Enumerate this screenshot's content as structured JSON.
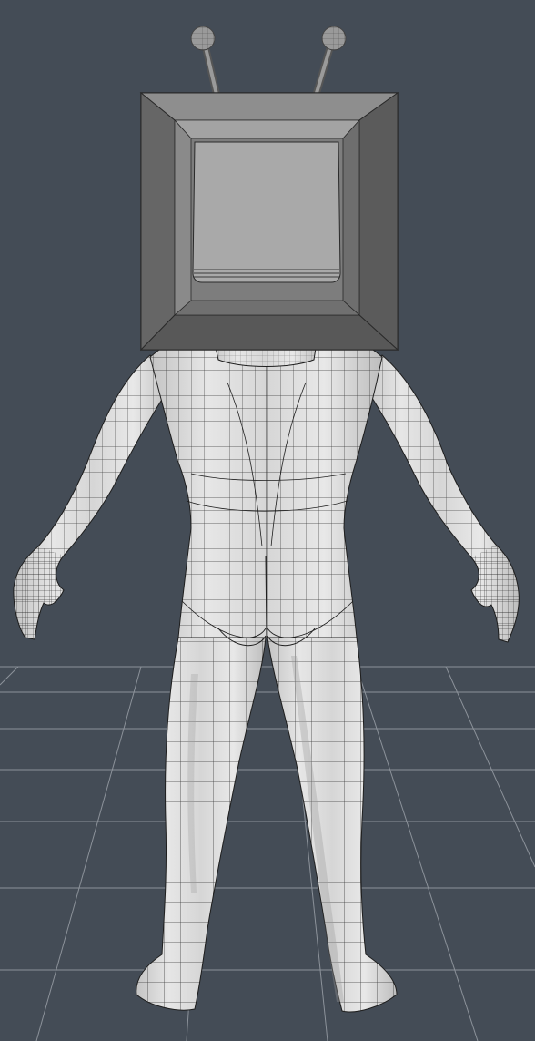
{
  "viewport": {
    "background_color": "#444c56",
    "grid_color": "#8c929a",
    "mesh_fill": "#dcdcdc",
    "mesh_shadow": "#b4b4b4",
    "wire_color": "#1e1e1e",
    "tv_outer": "#6b6b6b",
    "tv_bevel_light": "#8e8e8e",
    "tv_bevel_dark": "#585858",
    "tv_screen": "#a9a9a9",
    "icons": [
      "tv-head-model",
      "floor-grid"
    ]
  }
}
